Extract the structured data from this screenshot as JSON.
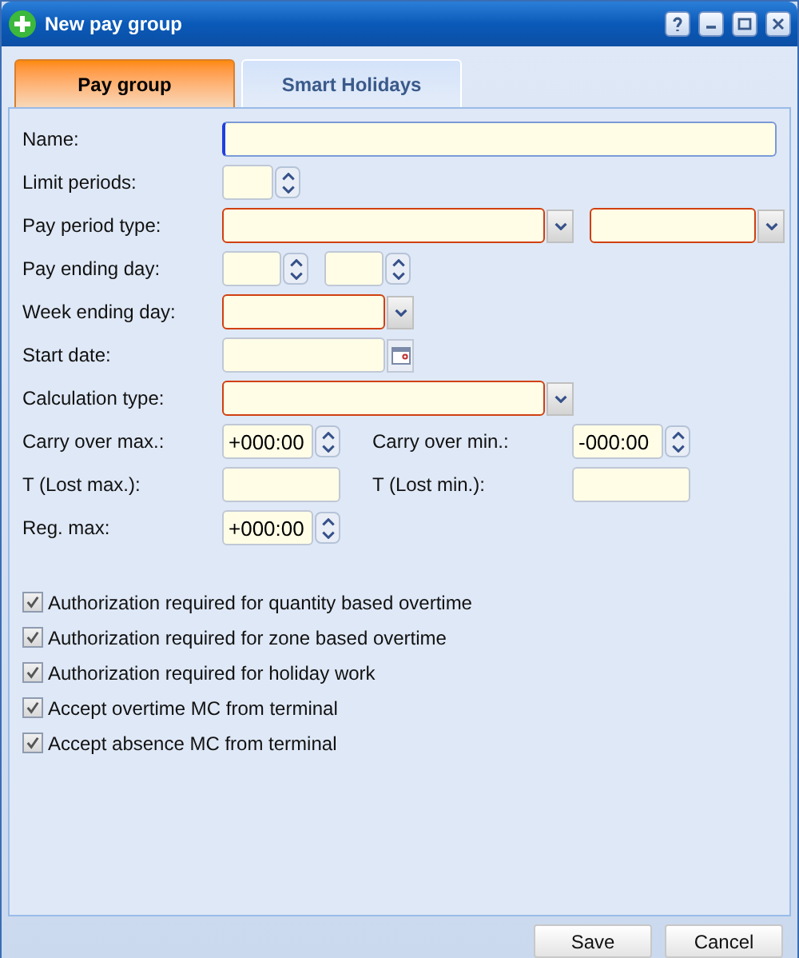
{
  "window": {
    "title": "New pay group"
  },
  "tabs": [
    {
      "label": "Pay group",
      "selected": true
    },
    {
      "label": "Smart Holidays",
      "selected": false
    }
  ],
  "rows": [
    {
      "label": "Name:",
      "inputs": [
        {
          "kind": "text",
          "focused": true,
          "required": false
        }
      ]
    },
    {
      "label": "Limit periods:",
      "inputs": [
        {
          "kind": "spinner",
          "focused": false,
          "required": false
        }
      ]
    },
    {
      "label": "Pay period type:",
      "inputs": [
        {
          "kind": "combo",
          "focused": false,
          "required": true
        },
        {
          "kind": "combo",
          "focused": false,
          "required": true
        }
      ]
    },
    {
      "label": "Pay ending day:",
      "inputs": [
        {
          "kind": "spinner",
          "focused": false,
          "required": false
        },
        {
          "kind": "spinner",
          "focused": false,
          "required": false
        }
      ]
    },
    {
      "label": "Week ending day:",
      "inputs": [
        {
          "kind": "combo",
          "focused": false,
          "required": true
        }
      ]
    },
    {
      "label": "Start date:",
      "inputs": [
        {
          "kind": "date",
          "focused": false,
          "required": false
        }
      ]
    },
    {
      "label": "Calculation type:",
      "inputs": [
        {
          "kind": "combo",
          "focused": false,
          "required": true
        }
      ]
    },
    {
      "label": "Carry over max.:",
      "inputs": [
        {
          "kind": "spinner",
          "value": "+000:00",
          "focused": false,
          "required": false
        }
      ],
      "right": {
        "label": "Carry over min.:",
        "inputs": [
          {
            "kind": "spinner",
            "value": "-000:00",
            "focused": false,
            "required": false
          }
        ]
      }
    },
    {
      "label": "T (Lost max.):",
      "inputs": [
        {
          "kind": "text",
          "focused": false,
          "required": false
        }
      ],
      "right": {
        "label": "T (Lost min.):",
        "inputs": [
          {
            "kind": "text",
            "focused": false,
            "required": false
          }
        ]
      }
    },
    {
      "label": "Reg. max:",
      "inputs": [
        {
          "kind": "spinner",
          "value": "+000:00",
          "focused": false,
          "required": false
        }
      ]
    }
  ],
  "checkboxes": [
    {
      "label": "Authorization required for quantity based overtime",
      "checked": true
    },
    {
      "label": "Authorization required for zone based overtime",
      "checked": true
    },
    {
      "label": "Authorization required for holiday work",
      "checked": true
    },
    {
      "label": "Accept overtime MC from terminal",
      "checked": true
    },
    {
      "label": "Accept absence MC from terminal",
      "checked": true
    }
  ],
  "buttons": [
    "Save",
    "Cancel"
  ]
}
